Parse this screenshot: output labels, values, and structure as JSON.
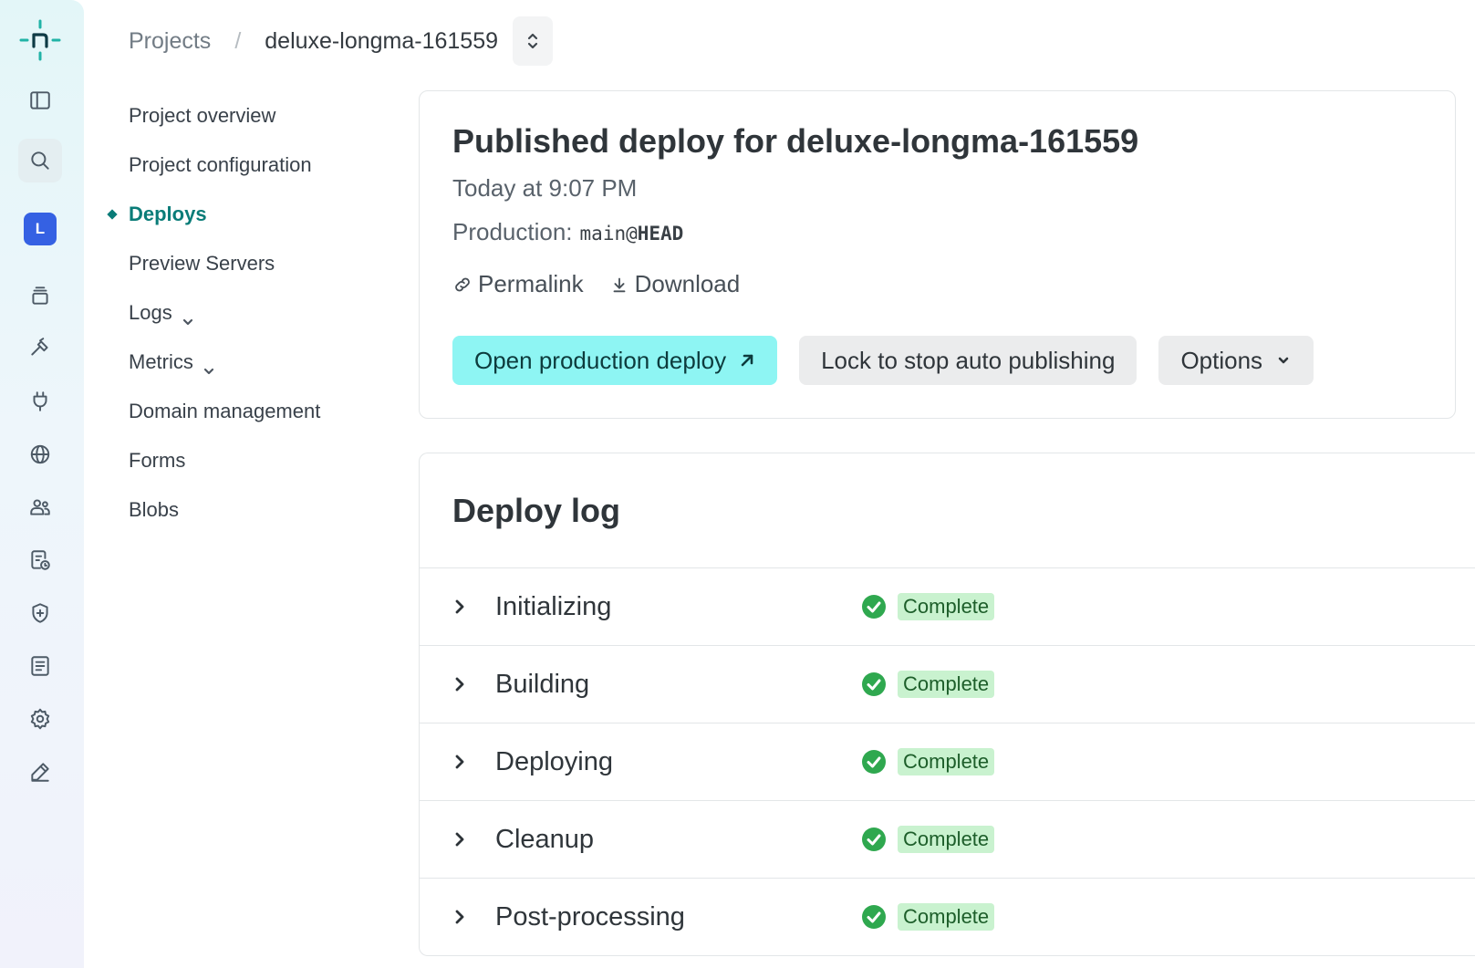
{
  "breadcrumb": {
    "projects": "Projects",
    "separator": "/",
    "site": "deluxe-longma-161559"
  },
  "rail": {
    "avatar_letter": "L",
    "icons": [
      "netlify-logo",
      "sidebar-toggle-icon",
      "search-icon",
      "team-avatar",
      "layers-icon",
      "hammer-icon",
      "plug-icon",
      "globe-icon",
      "users-icon",
      "forms-icon",
      "shield-icon",
      "log-icon",
      "gear-icon",
      "pencil-icon"
    ]
  },
  "subnav": {
    "items": [
      {
        "label": "Project overview"
      },
      {
        "label": "Project configuration"
      },
      {
        "label": "Deploys",
        "active": true
      },
      {
        "label": "Preview Servers"
      },
      {
        "label": "Logs",
        "has_dropdown": true
      },
      {
        "label": "Metrics",
        "has_dropdown": true
      },
      {
        "label": "Domain management"
      },
      {
        "label": "Forms"
      },
      {
        "label": "Blobs"
      }
    ]
  },
  "deploy": {
    "title": "Published deploy for deluxe-longma-161559",
    "time": "Today at 9:07 PM",
    "production_label": "Production:",
    "ref_branch": "main@",
    "ref_commit": "HEAD",
    "permalink_label": "Permalink",
    "download_label": "Download",
    "open_button": "Open production deploy",
    "lock_button": "Lock to stop auto publishing",
    "options_button": "Options"
  },
  "log": {
    "title": "Deploy log",
    "rows": [
      {
        "label": "Initializing",
        "status": "Complete"
      },
      {
        "label": "Building",
        "status": "Complete"
      },
      {
        "label": "Deploying",
        "status": "Complete"
      },
      {
        "label": "Cleanup",
        "status": "Complete"
      },
      {
        "label": "Post-processing",
        "status": "Complete"
      }
    ]
  },
  "colors": {
    "accent": "#0a7c78",
    "primary_button": "#8ef5f3",
    "success": "#2fa84f",
    "badge_bg": "#c9f2cf"
  }
}
